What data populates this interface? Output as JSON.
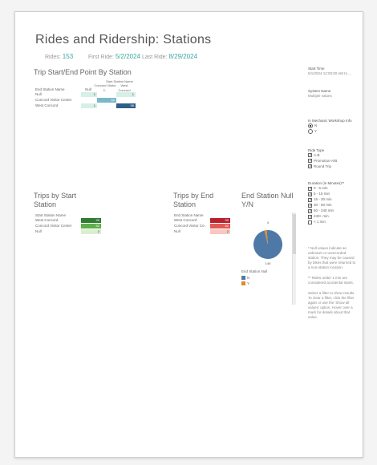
{
  "dashboard": {
    "title": "Rides and Ridership: Stations",
    "kpis": {
      "rides_label": "Rides:",
      "rides_value": "153",
      "first_label": "First Ride:",
      "first_value": "5/2/2024",
      "last_label": "Last Ride:",
      "last_value": "8/29/2024"
    }
  },
  "matrix": {
    "title": "Trip Start/End Point By Station",
    "top_header": "Start Station Name",
    "row_header": "End Station Name",
    "columns": [
      "Null",
      "Concord Visitor C..",
      "West Concord"
    ],
    "rows": [
      {
        "label": "Null",
        "values": [
          "1",
          "",
          "1"
        ]
      },
      {
        "label": "Concord Visitor Center",
        "values": [
          "",
          "52",
          ""
        ]
      },
      {
        "label": "West Concord",
        "values": [
          "1",
          "",
          "98"
        ]
      }
    ]
  },
  "trips_start": {
    "title_line1": "Trips by Start",
    "title_line2": "Station",
    "header": "Start Station Name",
    "rows": [
      {
        "label": "West Concord",
        "value": "99"
      },
      {
        "label": "Concord Visitor Center",
        "value": "52"
      },
      {
        "label": "Null",
        "value": "2"
      }
    ]
  },
  "trips_end": {
    "title_line1": "Trips by End",
    "title_line2": "Station",
    "header": "End Station Name",
    "rows": [
      {
        "label": "West Concord",
        "value": "99"
      },
      {
        "label": "Concord Visitor Ce..",
        "value": "52"
      },
      {
        "label": "Null",
        "value": "2"
      }
    ]
  },
  "pie": {
    "title_line1": "End Station Null",
    "title_line2": "Y/N",
    "top_value": "4",
    "bottom_value": "149",
    "legend_title": "End Station Null",
    "legend": [
      {
        "label": "N",
        "color": "#4e79a7"
      },
      {
        "label": "Y",
        "color": "#e08a2b"
      }
    ]
  },
  "chart_data": {
    "type": "pie",
    "title": "End Station Null Y/N",
    "slices": [
      {
        "label": "N",
        "value": 149,
        "color": "#4e79a7"
      },
      {
        "label": "Y",
        "value": 4,
        "color": "#e08a2b"
      }
    ]
  },
  "sidebar": {
    "start_time_label": "Start Time",
    "start_time_value": "5/1/2024 12:00:00 AM to ...",
    "system_name_label": "System Name",
    "system_name_value": "Multiple values",
    "mechanic_label": "In Mechanic Workshop Info",
    "mechanic_options": [
      {
        "label": "N",
        "selected": true
      },
      {
        "label": "Y",
        "selected": false
      }
    ],
    "ride_type_label": "Ride Type",
    "ride_types": [
      {
        "label": "A-B",
        "checked": true
      },
      {
        "label": "Promotion-A/B",
        "checked": true
      },
      {
        "label": "Round Trip",
        "checked": true
      }
    ],
    "duration_label": "Duration (in Minutes)**",
    "durations": [
      {
        "label": "0 - 5 min",
        "checked": true
      },
      {
        "label": "5 - 15 min",
        "checked": true
      },
      {
        "label": "15 - 30 min",
        "checked": true
      },
      {
        "label": "30 - 60 min",
        "checked": true
      },
      {
        "label": "60 - 240 min",
        "checked": true
      },
      {
        "label": "240+ min",
        "checked": true
      },
      {
        "label": "< 1 min",
        "checked": false
      }
    ],
    "note1": "* Null values indicate an unknown or unrecorded station. They may be caused by bikes that were returned to a non-station location.",
    "note2": "** Rides under 1 min are considered accidental starts.",
    "note3": "Select a filter to show results. To clear a filter, click the filter again or use the 'Show all values' option. Hover over a mark for details about that value."
  }
}
